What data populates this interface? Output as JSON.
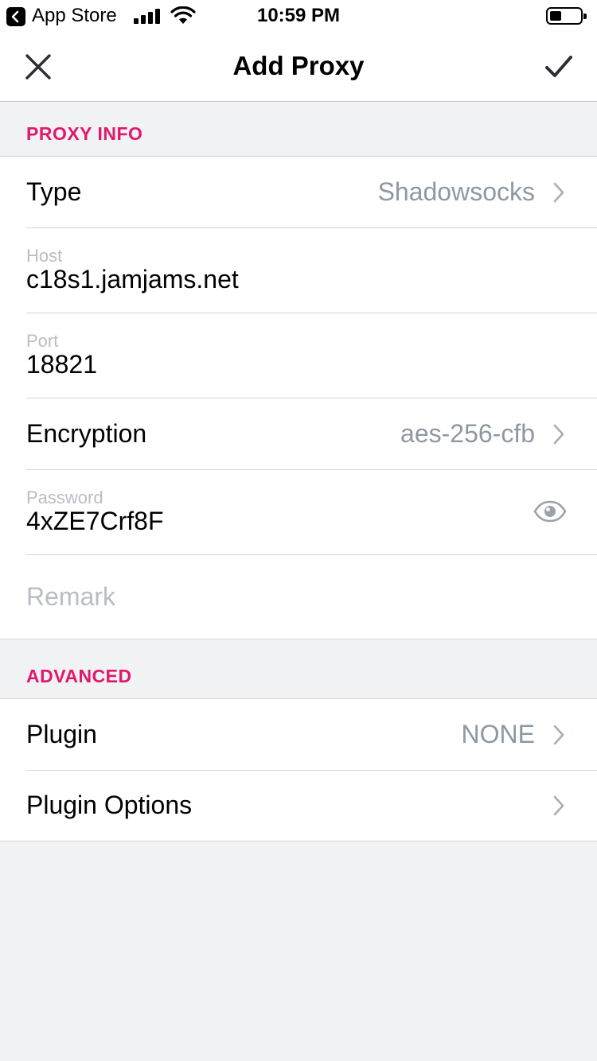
{
  "status_bar": {
    "back_app": "App Store",
    "time": "10:59 PM"
  },
  "nav": {
    "title": "Add Proxy",
    "close_icon": "close-icon",
    "confirm_icon": "checkmark-icon"
  },
  "sections": {
    "proxy_info": {
      "header": "PROXY INFO",
      "type": {
        "label": "Type",
        "value": "Shadowsocks"
      },
      "host": {
        "caption": "Host",
        "value": "c18s1.jamjams.net"
      },
      "port": {
        "caption": "Port",
        "value": "18821"
      },
      "encryption": {
        "label": "Encryption",
        "value": "aes-256-cfb"
      },
      "password": {
        "caption": "Password",
        "value": "4xZE7Crf8F"
      },
      "remark": {
        "placeholder": "Remark"
      }
    },
    "advanced": {
      "header": "ADVANCED",
      "plugin": {
        "label": "Plugin",
        "value": "NONE"
      },
      "plugin_options": {
        "label": "Plugin Options"
      }
    }
  },
  "colors": {
    "accent": "#e0186d",
    "secondary_text": "#8e98a3",
    "placeholder_text": "#b9bec4",
    "background": "#f1f2f4"
  }
}
